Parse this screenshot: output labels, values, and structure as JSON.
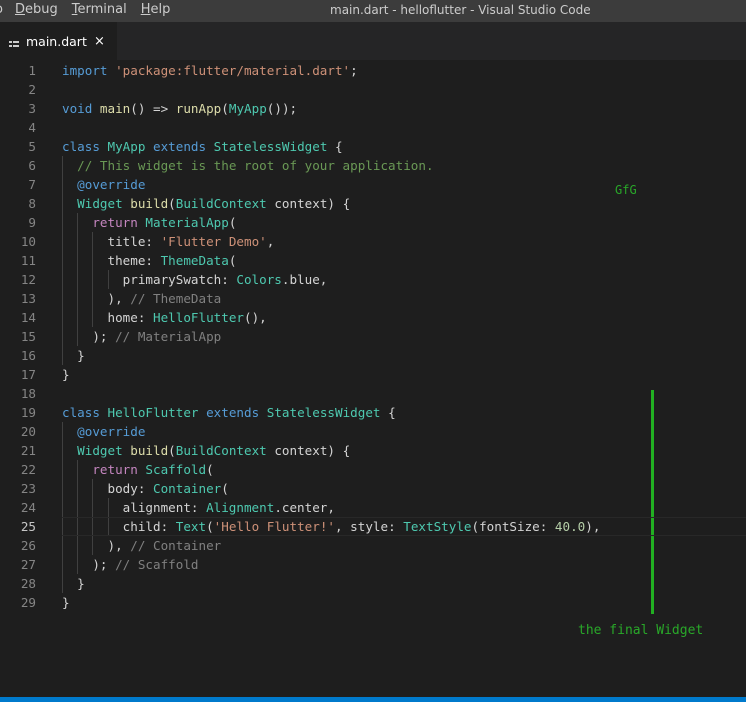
{
  "menu": [
    "o",
    "Debug",
    "Terminal",
    "Help"
  ],
  "window_title": "main.dart - helloflutter - Visual Studio Code",
  "tab": {
    "label": "main.dart",
    "close_glyph": "×"
  },
  "annotations": {
    "gfg": "GfG",
    "final_widget": "the final Widget"
  },
  "current_line": 25,
  "line_numbers": [
    "1",
    "2",
    "3",
    "4",
    "5",
    "6",
    "7",
    "8",
    "9",
    "10",
    "11",
    "12",
    "13",
    "14",
    "15",
    "16",
    "17",
    "18",
    "19",
    "20",
    "21",
    "22",
    "23",
    "24",
    "25",
    "26",
    "27",
    "28",
    "29"
  ],
  "code_lines": [
    [
      [
        "kw",
        "import "
      ],
      [
        "str",
        "'package:flutter/material.dart'"
      ],
      [
        "",
        "; "
      ]
    ],
    [],
    [
      [
        "kw",
        "void "
      ],
      [
        "fn",
        "main"
      ],
      [
        "",
        "() => "
      ],
      [
        "fn",
        "runApp"
      ],
      [
        "",
        "("
      ],
      [
        "cls",
        "MyApp"
      ],
      [
        "",
        "());"
      ]
    ],
    [],
    [
      [
        "kw",
        "class "
      ],
      [
        "cls",
        "MyApp "
      ],
      [
        "kw",
        "extends "
      ],
      [
        "cls",
        "StatelessWidget"
      ],
      [
        "",
        " {"
      ]
    ],
    [
      [
        "",
        "  "
      ],
      [
        "cm",
        "// This widget is the root of your application."
      ]
    ],
    [
      [
        "",
        "  "
      ],
      [
        "dec",
        "@override"
      ]
    ],
    [
      [
        "",
        "  "
      ],
      [
        "cls",
        "Widget "
      ],
      [
        "fn",
        "build"
      ],
      [
        "",
        "("
      ],
      [
        "cls",
        "BuildContext "
      ],
      [
        "",
        "context) {"
      ]
    ],
    [
      [
        "",
        "    "
      ],
      [
        "cf",
        "return "
      ],
      [
        "cls",
        "MaterialApp"
      ],
      [
        "",
        "("
      ]
    ],
    [
      [
        "",
        "      title: "
      ],
      [
        "str",
        "'Flutter Demo'"
      ],
      [
        "",
        ","
      ]
    ],
    [
      [
        "",
        "      theme: "
      ],
      [
        "cls",
        "ThemeData"
      ],
      [
        "",
        "("
      ]
    ],
    [
      [
        "",
        "        primarySwatch: "
      ],
      [
        "cls",
        "Colors"
      ],
      [
        "",
        ".blue,"
      ]
    ],
    [
      [
        "",
        "      ), "
      ],
      [
        "cm2",
        "// ThemeData"
      ]
    ],
    [
      [
        "",
        "      home: "
      ],
      [
        "cls",
        "HelloFlutter"
      ],
      [
        "",
        "(),"
      ]
    ],
    [
      [
        "",
        "    ); "
      ],
      [
        "cm2",
        "// MaterialApp"
      ]
    ],
    [
      [
        "",
        "  }"
      ]
    ],
    [
      [
        "",
        "}"
      ]
    ],
    [],
    [
      [
        "kw",
        "class "
      ],
      [
        "cls",
        "HelloFlutter "
      ],
      [
        "kw",
        "extends "
      ],
      [
        "cls",
        "StatelessWidget"
      ],
      [
        "",
        " {"
      ]
    ],
    [
      [
        "",
        "  "
      ],
      [
        "dec",
        "@override"
      ]
    ],
    [
      [
        "",
        "  "
      ],
      [
        "cls",
        "Widget "
      ],
      [
        "fn",
        "build"
      ],
      [
        "",
        "("
      ],
      [
        "cls",
        "BuildContext "
      ],
      [
        "",
        "context) {"
      ]
    ],
    [
      [
        "",
        "    "
      ],
      [
        "cf",
        "return "
      ],
      [
        "cls",
        "Scaffold"
      ],
      [
        "",
        "("
      ]
    ],
    [
      [
        "",
        "      body: "
      ],
      [
        "cls",
        "Container"
      ],
      [
        "",
        "("
      ]
    ],
    [
      [
        "",
        "        alignment: "
      ],
      [
        "cls",
        "Alignment"
      ],
      [
        "",
        ".center,"
      ]
    ],
    [
      [
        "",
        "        child: "
      ],
      [
        "cls",
        "Text"
      ],
      [
        "",
        "("
      ],
      [
        "str",
        "'Hello Flutter!'"
      ],
      [
        "",
        ", style: "
      ],
      [
        "cls",
        "TextStyle"
      ],
      [
        "",
        "(fontSize: "
      ],
      [
        "num",
        "40.0"
      ],
      [
        "",
        "),"
      ]
    ],
    [
      [
        "",
        "      ), "
      ],
      [
        "cm2",
        "// Container"
      ]
    ],
    [
      [
        "",
        "    ); "
      ],
      [
        "cm2",
        "// Scaffold"
      ]
    ],
    [
      [
        "",
        "  }"
      ]
    ],
    [
      [
        "",
        "}"
      ]
    ]
  ]
}
